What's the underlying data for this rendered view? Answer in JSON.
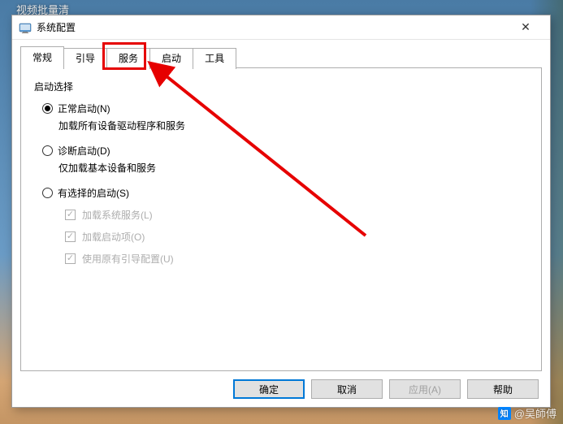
{
  "background": {
    "top_text": "视频批量清"
  },
  "dialog": {
    "title": "系统配置",
    "close_label": "✕"
  },
  "tabs": {
    "items": [
      {
        "label": "常规",
        "active": true
      },
      {
        "label": "引导",
        "active": false
      },
      {
        "label": "服务",
        "active": false
      },
      {
        "label": "启动",
        "active": false
      },
      {
        "label": "工具",
        "active": false
      }
    ]
  },
  "panel": {
    "fieldset_label": "启动选择",
    "options": [
      {
        "label": "正常启动(N)",
        "sub": "加载所有设备驱动程序和服务",
        "checked": true
      },
      {
        "label": "诊断启动(D)",
        "sub": "仅加载基本设备和服务",
        "checked": false
      },
      {
        "label": "有选择的启动(S)",
        "sub": "",
        "checked": false
      }
    ],
    "checkboxes": [
      {
        "label": "加载系统服务(L)"
      },
      {
        "label": "加载启动项(O)"
      },
      {
        "label": "使用原有引导配置(U)"
      }
    ]
  },
  "buttons": {
    "ok": "确定",
    "cancel": "取消",
    "apply": "应用(A)",
    "help": "帮助"
  },
  "watermark": {
    "text": "@吴師傅"
  },
  "annotation": {
    "highlight_color": "#e60000"
  }
}
